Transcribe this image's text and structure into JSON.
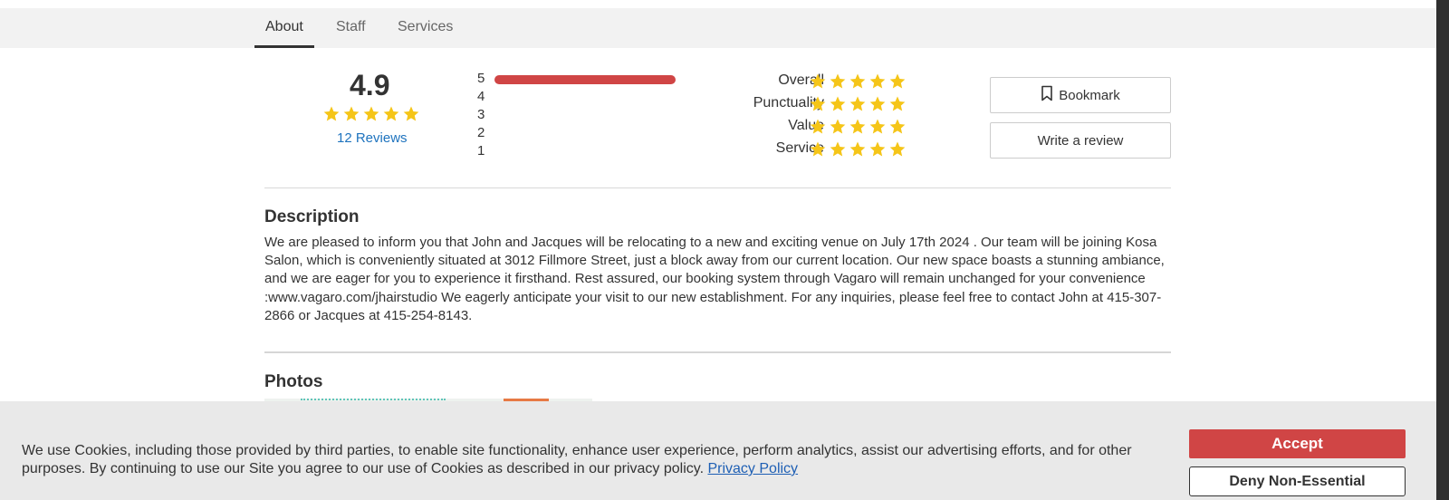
{
  "tabs": [
    {
      "label": "About",
      "active": true
    },
    {
      "label": "Staff",
      "active": false
    },
    {
      "label": "Services",
      "active": false
    }
  ],
  "rating": {
    "average": "4.9",
    "stars": 5,
    "reviews_link": "12 Reviews"
  },
  "distribution": [
    {
      "label": "5",
      "fraction": 1.0
    },
    {
      "label": "4",
      "fraction": 0
    },
    {
      "label": "3",
      "fraction": 0
    },
    {
      "label": "2",
      "fraction": 0
    },
    {
      "label": "1",
      "fraction": 0
    }
  ],
  "categories": [
    {
      "label": "Overall",
      "stars": 5
    },
    {
      "label": "Punctuality",
      "stars": 5
    },
    {
      "label": "Value",
      "stars": 5
    },
    {
      "label": "Service",
      "stars": 5
    }
  ],
  "actions": {
    "bookmark_label": "Bookmark",
    "bookmark_icon": "bookmark-icon",
    "write_review_label": "Write a review"
  },
  "description": {
    "title": "Description",
    "body": "We are pleased to inform you that John and Jacques will be relocating to a new and exciting venue on July 17th 2024 . Our team will be joining Kosa Salon, which is conveniently situated at 3012 Fillmore Street, just a block away from our current location. Our new space boasts a stunning ambiance, and we are eager for you to experience it firsthand. Rest assured, our booking system through Vagaro will remain unchanged for your convenience :www.vagaro.com/jhairstudio We eagerly anticipate your visit to our new establishment. For any inquiries, please feel free to contact John at 415-307-2866 or Jacques at 415-254-8143."
  },
  "photos": {
    "title": "Photos"
  },
  "cookie_banner": {
    "text": "We use Cookies, including those provided by third parties, to enable site functionality, enhance user experience, perform analytics, assist our advertising efforts, and for other purposes. By continuing to use our Site you agree to our use of Cookies as described in our privacy policy.",
    "link_label": "Privacy Policy",
    "accept_label": "Accept",
    "deny_label": "Deny Non-Essential"
  },
  "colors": {
    "star": "#f5c518",
    "accent_red": "#d04545",
    "link_blue": "#1e73be"
  }
}
